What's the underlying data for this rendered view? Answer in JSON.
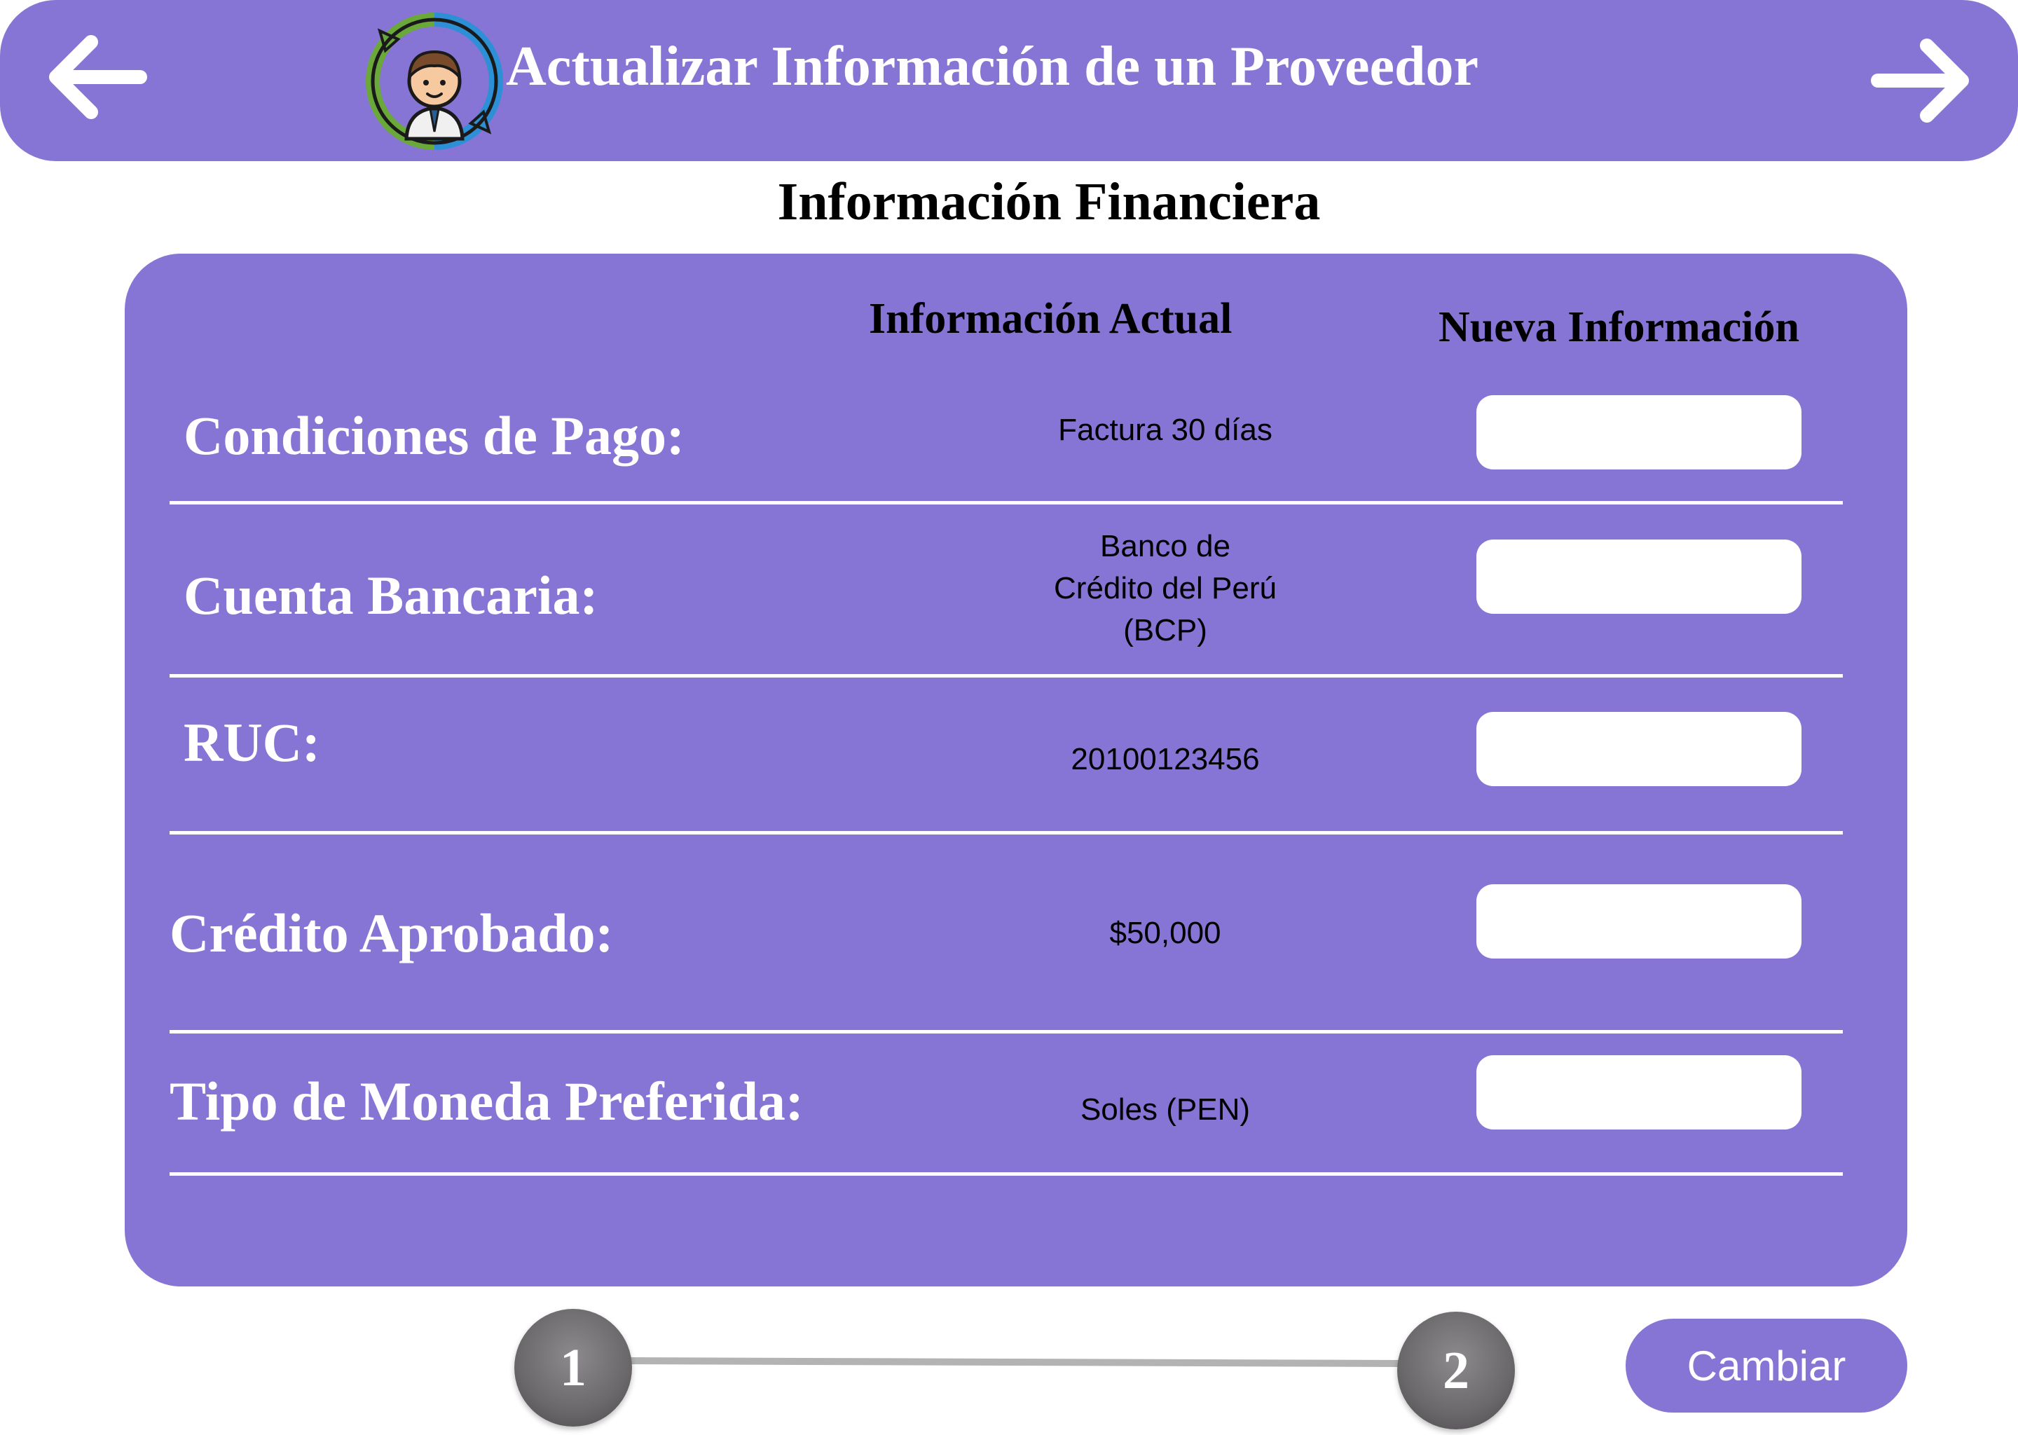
{
  "header": {
    "title": "Actualizar Información de un Proveedor",
    "back_icon": "arrow-left-icon",
    "forward_icon": "arrow-right-icon",
    "logo_icon": "supplier-update-icon"
  },
  "section": {
    "title": "Información Financiera"
  },
  "table": {
    "col_current": "Información Actual",
    "col_new": "Nueva Información",
    "rows": [
      {
        "label": "Condiciones de Pago:",
        "current": "Factura 30 días",
        "new_value": ""
      },
      {
        "label": "Cuenta Bancaria:",
        "current_lines": [
          "Banco de",
          "Crédito del Perú",
          "(BCP)"
        ],
        "new_value": ""
      },
      {
        "label": "RUC:",
        "current": "20100123456",
        "new_value": ""
      },
      {
        "label": "Crédito Aprobado:",
        "current": "$50,000",
        "new_value": ""
      },
      {
        "label": "Tipo de Moneda Preferida:",
        "current": "Soles (PEN)",
        "new_value": ""
      }
    ]
  },
  "stepper": {
    "steps": [
      "1",
      "2"
    ]
  },
  "actions": {
    "change_label": "Cambiar"
  },
  "colors": {
    "accent": "#8675d4",
    "step": "#6b686b",
    "text_on_accent": "#ffffff"
  }
}
